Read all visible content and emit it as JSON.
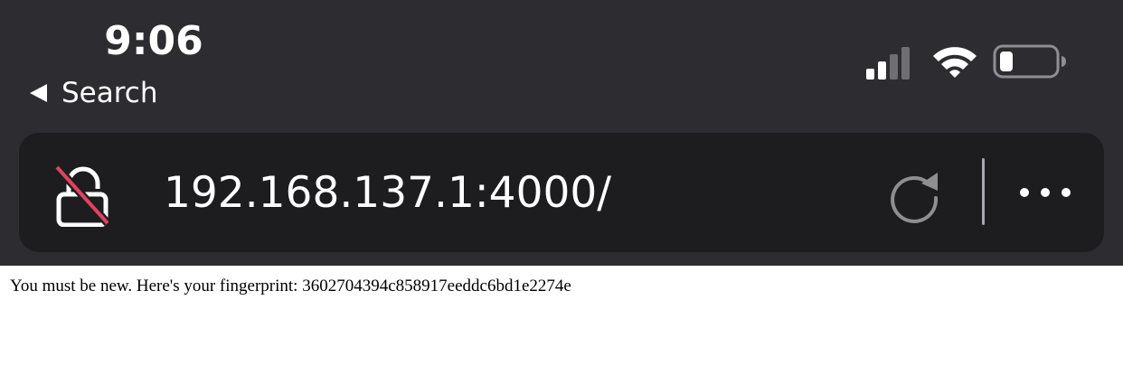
{
  "status_bar": {
    "time": "9:06",
    "back_label": "Search",
    "icons": [
      "signal-icon",
      "wifi-icon",
      "battery-icon"
    ]
  },
  "url_bar": {
    "url": "192.168.137.1:4000/",
    "security_icon": "insecure-lock-icon",
    "actions": [
      "reload-icon",
      "more-icon"
    ]
  },
  "page": {
    "message": "You must be new. Here's your fingerprint: 3602704394c858917eeddc6bd1e2274e"
  },
  "colors": {
    "chrome_bg": "#2c2c31",
    "url_bar_bg": "#1d1d20",
    "insecure_slash": "#e0435d",
    "icon_gray": "#8e8e93"
  }
}
